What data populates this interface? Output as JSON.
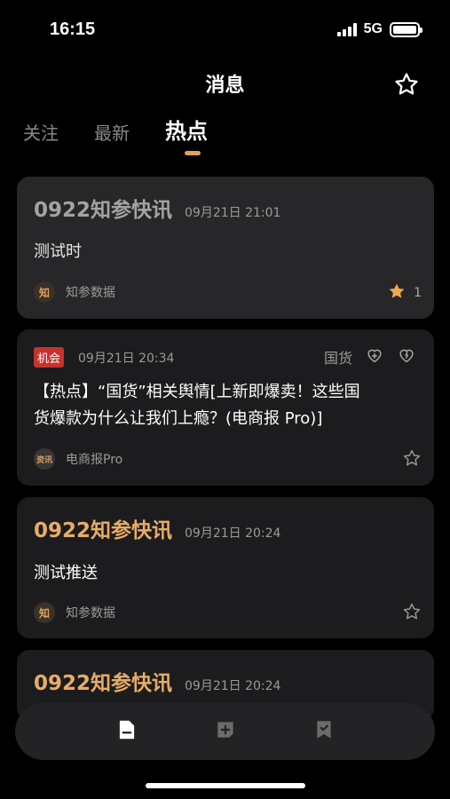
{
  "status_bar": {
    "time": "16:15",
    "network": "5G"
  },
  "header": {
    "title": "消息"
  },
  "tabs": [
    {
      "label": "关注",
      "active": false
    },
    {
      "label": "最新",
      "active": false
    },
    {
      "label": "热点",
      "active": true
    }
  ],
  "feed": [
    {
      "title": "0922知参快讯",
      "time": "09月21日 21:01",
      "body": "测试时",
      "source": "知参数据",
      "source_logo": "知",
      "favorite_count": "1",
      "favorited": true
    },
    {
      "tag": "机会",
      "time": "09月21日 20:34",
      "category": "国货",
      "body_line1": "【热点】“国货”相关舆情[上新即爆卖！这些国",
      "body_line2": "货爆款为什么让我们上瘾？(电商报 Pro)]",
      "source": "电商报Pro",
      "source_logo": "资讯"
    },
    {
      "title": "0922知参快讯",
      "time": "09月21日 20:24",
      "body": "测试推送",
      "source": "知参数据",
      "source_logo": "知"
    },
    {
      "title": "0922知参快讯",
      "time": "09月21日 20:24"
    }
  ],
  "colors": {
    "accent": "#e8ac66",
    "tag_red": "#c8312d",
    "favorite": "#f0a94e"
  },
  "icons": {
    "header_action": "star-outline-icon",
    "nav": [
      "document-icon",
      "add-note-icon",
      "bookmark-icon"
    ]
  }
}
